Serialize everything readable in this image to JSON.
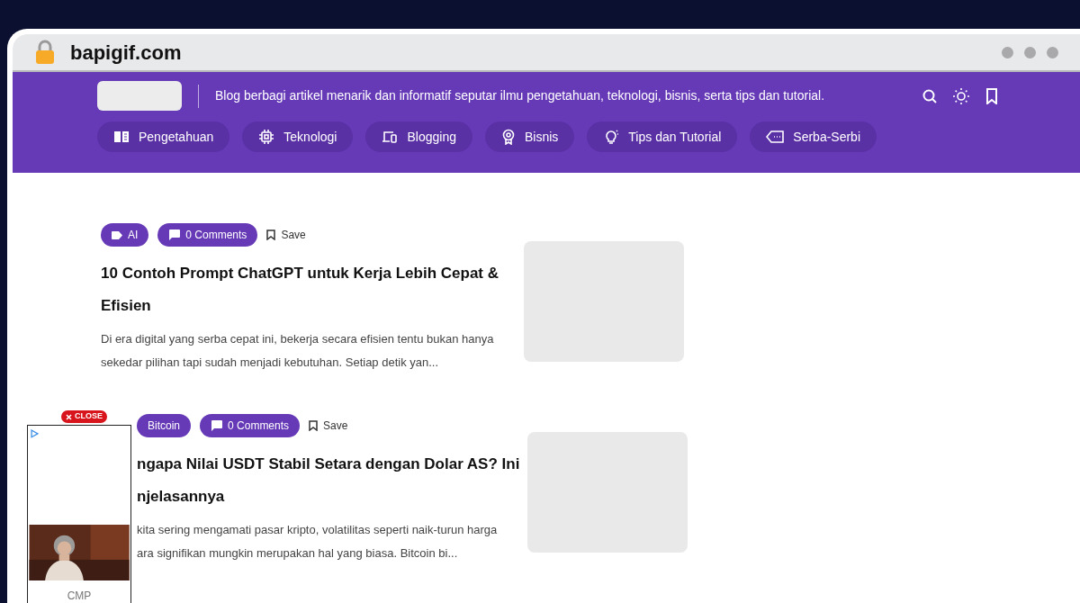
{
  "browser": {
    "address": "bapigif.com"
  },
  "header": {
    "tagline": "Blog berbagi artikel menarik dan informatif seputar ilmu pengetahuan, teknologi, bisnis, serta tips dan tutorial.",
    "categories": [
      {
        "label": "Pengetahuan"
      },
      {
        "label": "Teknologi"
      },
      {
        "label": "Blogging"
      },
      {
        "label": "Bisnis"
      },
      {
        "label": "Tips dan Tutorial"
      },
      {
        "label": "Serba-Serbi"
      }
    ]
  },
  "articles": [
    {
      "tag": "AI",
      "tag_icon": true,
      "comments": "0 Comments",
      "save": "Save",
      "title_lines": [
        "10 Contoh Prompt ChatGPT untuk Kerja Lebih Cepat &",
        "Efisien"
      ],
      "excerpt_lines": [
        "Di era digital yang serba cepat ini, bekerja secara efisien tentu bukan hanya",
        "sekedar pilihan tapi sudah menjadi kebutuhan. Setiap detik yan..."
      ]
    },
    {
      "tag": "Bitcoin",
      "tag_icon": false,
      "comments": "0 Comments",
      "save": "Save",
      "title_lines": [
        "ngapa Nilai USDT Stabil Setara dengan Dolar AS? Ini",
        "njelasannya"
      ],
      "excerpt_lines": [
        "kita sering mengamati pasar kripto, volatilitas seperti naik-turun harga",
        "ara signifikan mungkin merupakan hal yang biasa. Bitcoin bi..."
      ]
    }
  ],
  "ad": {
    "close": "CLOSE",
    "caption": "CMP"
  }
}
